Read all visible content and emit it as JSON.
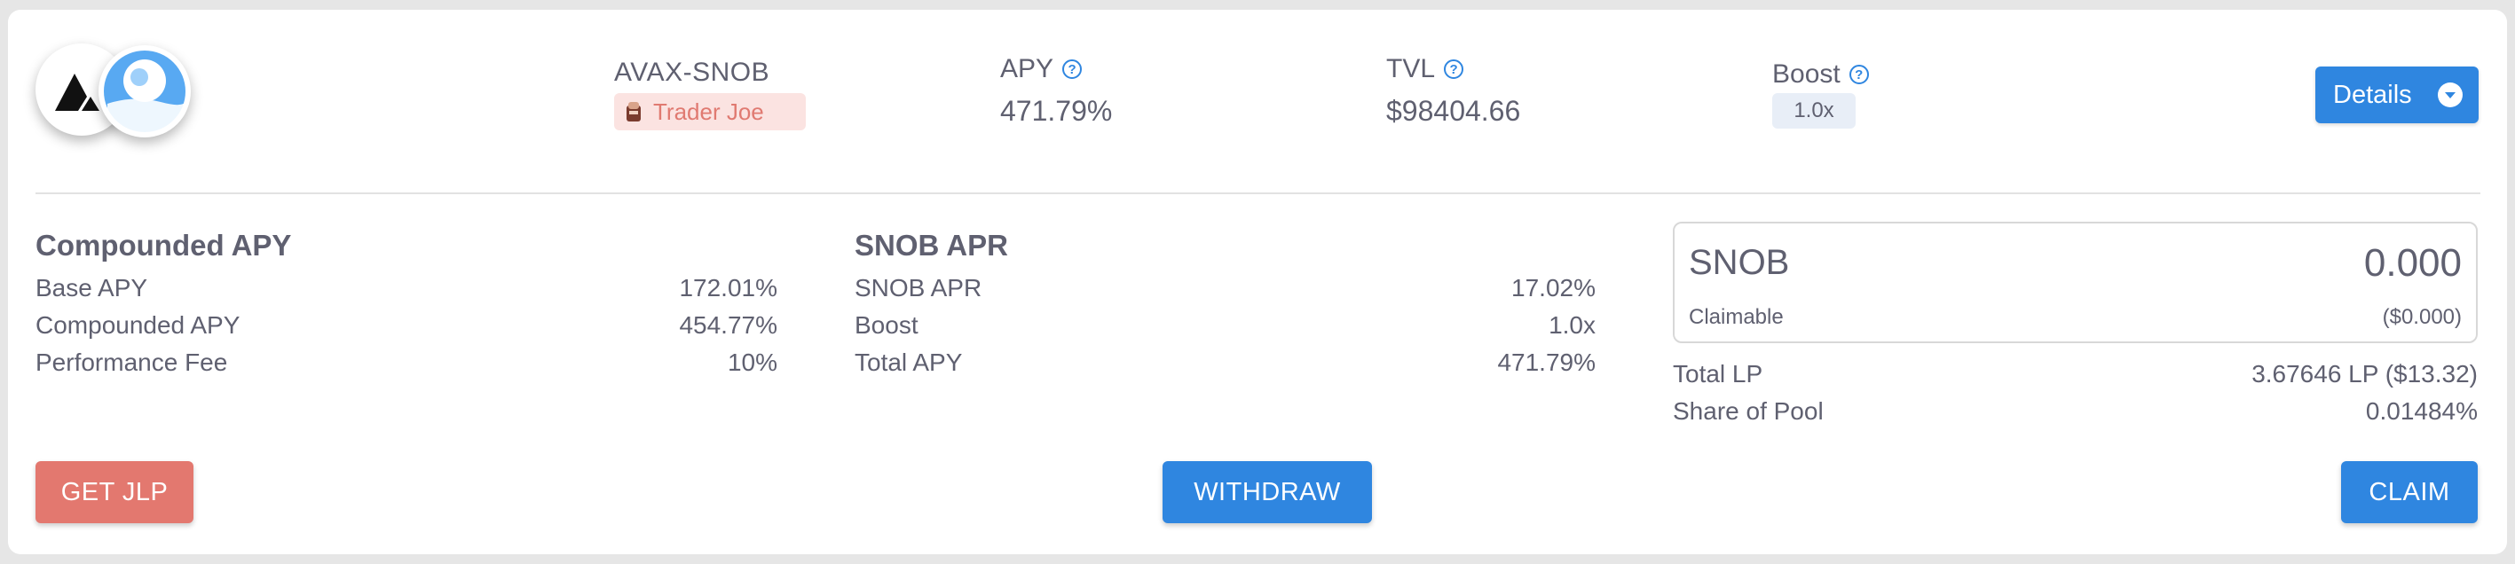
{
  "pool": {
    "pair": "AVAX-SNOB",
    "dex": "Trader Joe",
    "logos": [
      "avax-logo",
      "snob-logo"
    ]
  },
  "header": {
    "apy_label": "APY",
    "apy_value": "471.79%",
    "tvl_label": "TVL",
    "tvl_value": "$98404.66",
    "boost_label": "Boost",
    "boost_value": "1.0x",
    "details_label": "Details"
  },
  "compounded": {
    "title": "Compounded APY",
    "rows": [
      {
        "label": "Base APY",
        "value": "172.01%"
      },
      {
        "label": "Compounded APY",
        "value": "454.77%"
      },
      {
        "label": "Performance Fee",
        "value": "10%"
      }
    ]
  },
  "snob_apr": {
    "title": "SNOB APR",
    "rows": [
      {
        "label": "SNOB APR",
        "value": "17.02%"
      },
      {
        "label": "Boost",
        "value": "1.0x"
      },
      {
        "label": "Total APY",
        "value": "471.79%"
      }
    ]
  },
  "claim": {
    "token": "SNOB",
    "amount": "0.000",
    "claimable_label": "Claimable",
    "claimable_usd": "($0.000)"
  },
  "position": {
    "rows": [
      {
        "label": "Total LP",
        "value": "3.67646 LP ($13.32)"
      },
      {
        "label": "Share of Pool",
        "value": "0.01484%"
      }
    ]
  },
  "actions": {
    "get_lp_label": "GET JLP",
    "withdraw_label": "WITHDRAW",
    "claim_label": "CLAIM"
  },
  "colors": {
    "primary": "#2f86e0",
    "danger": "#e3786f",
    "badge_dex_bg": "#fbe3e1",
    "text": "#5f6070"
  }
}
